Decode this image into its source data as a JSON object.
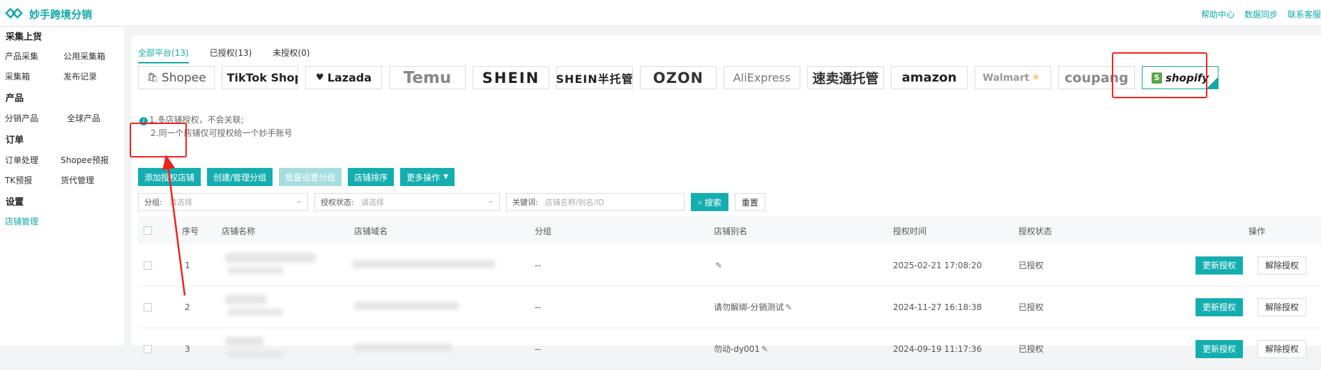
{
  "app": {
    "title": "妙手跨境分销",
    "brand_color": "#10a9a8"
  },
  "top_links": [
    "帮助中心",
    "数据同步",
    "联系客服"
  ],
  "sidebar": {
    "groups": [
      {
        "title": "采集上货",
        "items": [
          "产品采集",
          "公用采集箱",
          "采集箱",
          "发布记录"
        ]
      },
      {
        "title": "产品",
        "items": [
          "分销产品",
          "全球产品"
        ]
      },
      {
        "title": "订单",
        "items": [
          "订单处理",
          "Shopee预报",
          "TK预报",
          "货代管理"
        ]
      },
      {
        "title": "设置",
        "items": [
          "店铺管理"
        ]
      }
    ],
    "active": "店铺管理"
  },
  "tabs": [
    {
      "label": "全部平台(13)",
      "active": true
    },
    {
      "label": "已授权(13)",
      "active": false
    },
    {
      "label": "未授权(0)",
      "active": false
    }
  ],
  "platforms": [
    "Shopee",
    "TikTok Shop",
    "Lazada",
    "Temu",
    "SHEIN",
    "SHEIN半托管",
    "OZON",
    "AliExpress",
    "速卖通托管",
    "amazon",
    "Walmart",
    "coupang",
    "shopify"
  ],
  "selected_platform": "shopify",
  "tips": [
    "1.多店铺授权，不会关联;",
    "2.同一个店铺仅可授权给一个妙手账号"
  ],
  "actions": {
    "add": "添加授权店铺",
    "create_group": "创建/管理分组",
    "batch_group": "批量设置分组",
    "sort": "店铺排序",
    "more": "更多操作"
  },
  "filters": {
    "group_label": "分组:",
    "group_placeholder": "请选择",
    "status_label": "授权状态:",
    "status_placeholder": "请选择",
    "keyword_label": "关键词:",
    "keyword_placeholder": "店铺名称/别名/ID",
    "search": "搜索",
    "reset": "重置"
  },
  "table": {
    "headers": [
      "序号",
      "店铺名称",
      "店铺域名",
      "分组",
      "店铺别名",
      "授权时间",
      "授权状态",
      "操作"
    ],
    "rows": [
      {
        "index": "1",
        "group": "--",
        "alias": "",
        "time": "2025-02-21 17:08:20",
        "status": "已授权"
      },
      {
        "index": "2",
        "group": "--",
        "alias": "请勿解绑-分销测试",
        "time": "2024-11-27 16:18:38",
        "status": "已授权"
      },
      {
        "index": "3",
        "group": "--",
        "alias": "勿动-dy001",
        "time": "2024-09-19 11:17:36",
        "status": "已授权"
      }
    ],
    "update_label": "更新授权",
    "remove_label": "解除授权"
  }
}
